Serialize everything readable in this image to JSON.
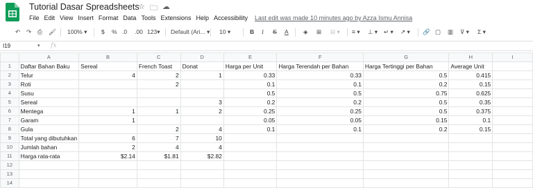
{
  "app": {
    "doc_title": "Tutorial Dasar Spreadsheets",
    "menu": [
      "File",
      "Edit",
      "View",
      "Insert",
      "Format",
      "Data",
      "Tools",
      "Extensions",
      "Help",
      "Accessibility"
    ],
    "last_edit": "Last edit was made 10 minutes ago by Azza Ismu Annisa"
  },
  "toolbar": {
    "zoom": "100%",
    "currency": "$",
    "percent": "%",
    "dec_decrease": ".0",
    "dec_increase": ".00",
    "more_formats": "123",
    "font": "Default (Ari...",
    "font_size": "10",
    "bold": "B",
    "italic": "I",
    "strike": "S",
    "text_color": "A"
  },
  "formula": {
    "cell_ref": "I19",
    "fx": "fx"
  },
  "grid": {
    "columns": [
      "A",
      "B",
      "C",
      "D",
      "E",
      "F",
      "G",
      "H",
      "I"
    ],
    "rows": [
      [
        "Daftar Bahan Baku",
        "Sereal",
        "French Toast",
        "Donat",
        "Harga per Unit",
        "Harga Terendah per Bahan",
        "Harga Tertinggi per Bahan",
        "Average Unit",
        ""
      ],
      [
        "Telur",
        "4",
        "2",
        "1",
        "0.33",
        "0.33",
        "0.5",
        "0.415",
        ""
      ],
      [
        "Roti",
        "",
        "2",
        "",
        "0.1",
        "0.1",
        "0.2",
        "0.15",
        ""
      ],
      [
        "Susu",
        "",
        "",
        "",
        "0.5",
        "0.5",
        "0.75",
        "0.625",
        ""
      ],
      [
        "Sereal",
        "",
        "",
        "3",
        "0.2",
        "0.2",
        "0.5",
        "0.35",
        ""
      ],
      [
        "Mentega",
        "1",
        "1",
        "2",
        "0.25",
        "0.25",
        "0.5",
        "0.375",
        ""
      ],
      [
        "Garam",
        "1",
        "",
        "",
        "0.05",
        "0.05",
        "0.15",
        "0.1",
        ""
      ],
      [
        "Gula",
        "",
        "2",
        "4",
        "0.1",
        "0.1",
        "0.2",
        "0.15",
        ""
      ],
      [
        "Total yang dibutuhkan",
        "6",
        "7",
        "10",
        "",
        "",
        "",
        "",
        ""
      ],
      [
        "Jumlah bahan",
        "2",
        "4",
        "4",
        "",
        "",
        "",
        "",
        ""
      ],
      [
        "Harga rata-rata",
        "$2.14",
        "$1.81",
        "$2.82",
        "",
        "",
        "",
        "",
        ""
      ],
      [
        "",
        "",
        "",
        "",
        "",
        "",
        "",
        "",
        ""
      ],
      [
        "",
        "",
        "",
        "",
        "",
        "",
        "",
        "",
        ""
      ],
      [
        "",
        "",
        "",
        "",
        "",
        "",
        "",
        "",
        ""
      ]
    ]
  },
  "colors": {
    "sheets_green": "#0f9d58",
    "header_bg": "#f8f9fa"
  }
}
